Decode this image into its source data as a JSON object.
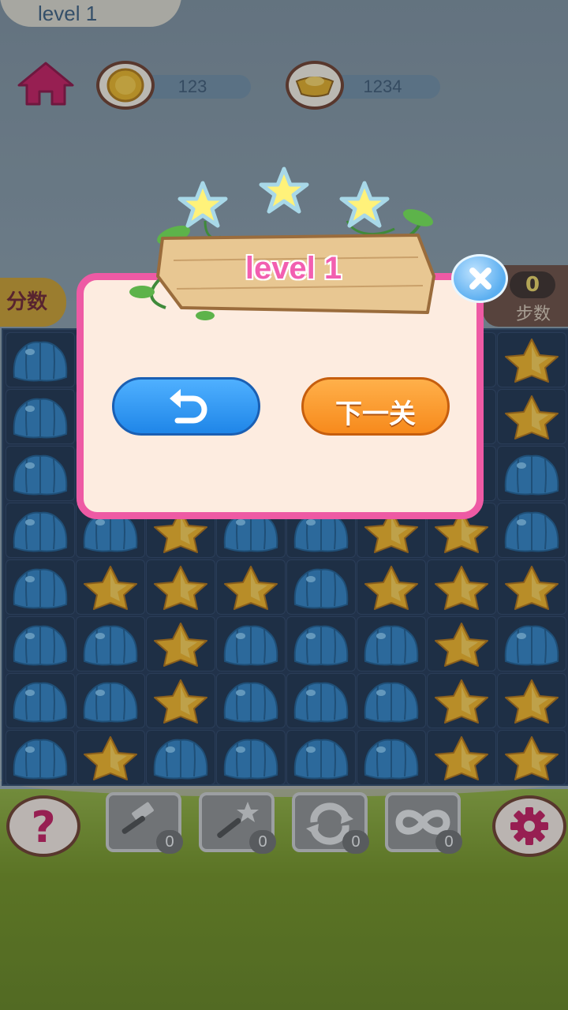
{
  "header": {
    "level_tab": "level 1",
    "coins": "123",
    "gold": "1234"
  },
  "side": {
    "score_label": "分数",
    "steps_value": "0",
    "steps_label": "步数"
  },
  "modal": {
    "title": "level 1",
    "stars": 3,
    "next_button": "下一关"
  },
  "tools": [
    {
      "name": "hammer",
      "count": "0"
    },
    {
      "name": "magic-wand",
      "count": "0"
    },
    {
      "name": "shuffle",
      "count": "0"
    },
    {
      "name": "infinity",
      "count": "0"
    }
  ],
  "board": {
    "cols": 8,
    "rows": 8,
    "cells": [
      "b",
      "",
      "",
      "",
      "",
      "",
      "",
      "s",
      "b",
      "",
      "",
      "",
      "",
      "",
      "",
      "s",
      "b",
      "",
      "",
      "",
      "",
      "",
      "",
      "b",
      "b",
      "b",
      "s",
      "b",
      "b",
      "s",
      "s",
      "b",
      "b",
      "s",
      "s",
      "s",
      "b",
      "s",
      "s",
      "s",
      "b",
      "b",
      "s",
      "b",
      "b",
      "b",
      "s",
      "b",
      "b",
      "b",
      "s",
      "b",
      "b",
      "b",
      "s",
      "s",
      "b",
      "s",
      "b",
      "b",
      "b",
      "b",
      "s",
      "s"
    ]
  },
  "colors": {
    "modal_border": "#ee5aa4",
    "title_pink": "#f25fb0",
    "replay_blue": "#1f86e8",
    "next_orange": "#f78a1c",
    "jelly_blue": "#2f7fc0",
    "star_yellow": "#f0b020"
  }
}
